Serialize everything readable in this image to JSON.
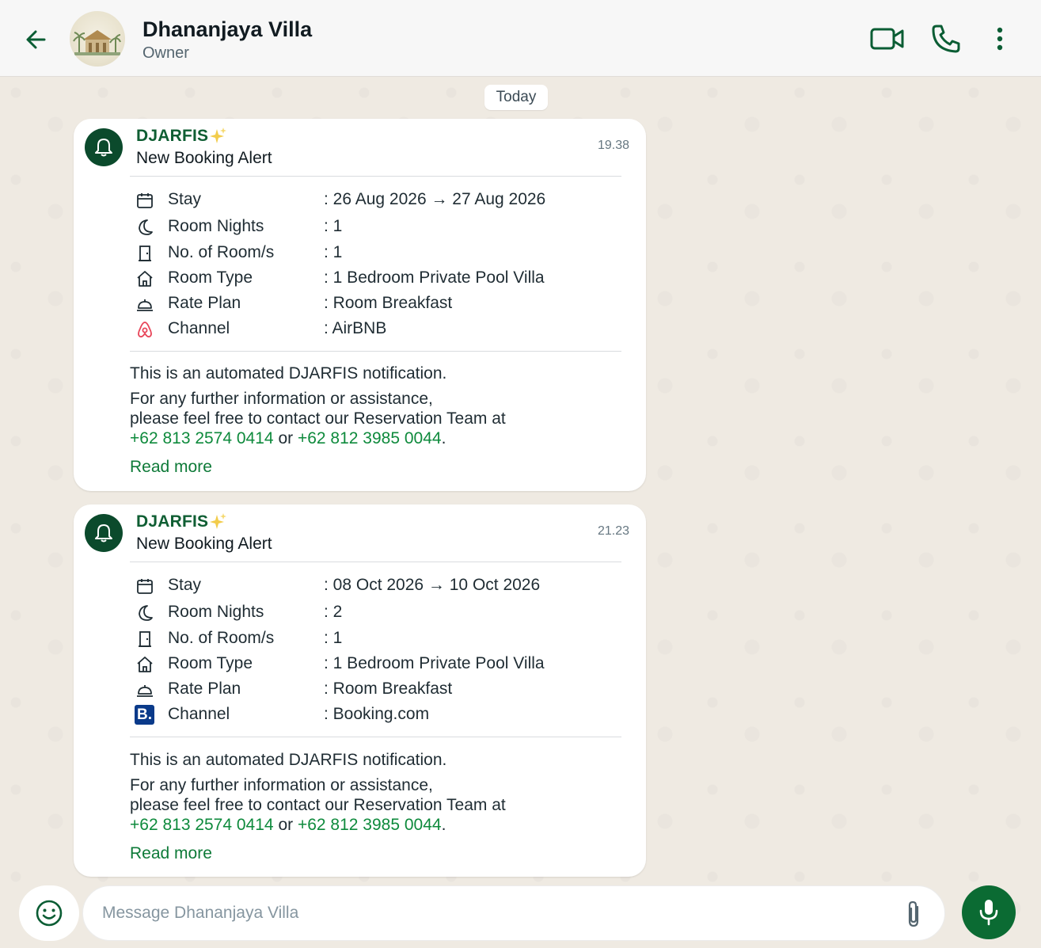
{
  "header": {
    "contact_name": "Dhananjaya Villa",
    "contact_subtitle": "Owner",
    "icons": [
      "back-arrow-icon",
      "villa-avatar",
      "video-call-icon",
      "phone-call-icon",
      "more-options-icon"
    ]
  },
  "date_chip": "Today",
  "messages": [
    {
      "sender": "DJARFIS",
      "title": "New Booking Alert",
      "time": "19.38",
      "rows": [
        {
          "icon": "calendar-icon",
          "label": "Stay",
          "value": ": 26 Aug 2026 → 27 Aug 2026"
        },
        {
          "icon": "moon-icon",
          "label": "Room Nights",
          "value": ": 1"
        },
        {
          "icon": "door-icon",
          "label": "No. of Room/s",
          "value": ": 1"
        },
        {
          "icon": "house-icon",
          "label": "Room Type",
          "value": ": 1 Bedroom Private Pool Villa"
        },
        {
          "icon": "cloche-icon",
          "label": "Rate Plan",
          "value": ": Room Breakfast"
        },
        {
          "icon": "airbnb-icon",
          "label": "Channel",
          "value": ": AirBNB"
        }
      ],
      "note": "This is an automated DJARFIS notification.",
      "contact_line1": "For any further information or assistance,",
      "contact_line2": "please feel free to contact our Reservation Team at",
      "phone1": "+62 813 2574 0414",
      "or": " or ",
      "phone2": "+62 812 3985 0044",
      "period": ".",
      "read_more": "Read more"
    },
    {
      "sender": "DJARFIS",
      "title": "New Booking Alert",
      "time": "21.23",
      "rows": [
        {
          "icon": "calendar-icon",
          "label": "Stay",
          "value": ": 08 Oct 2026 → 10 Oct 2026"
        },
        {
          "icon": "moon-icon",
          "label": "Room Nights",
          "value": ": 2"
        },
        {
          "icon": "door-icon",
          "label": "No. of Room/s",
          "value": ": 1"
        },
        {
          "icon": "house-icon",
          "label": "Room Type",
          "value": ": 1 Bedroom Private Pool Villa"
        },
        {
          "icon": "cloche-icon",
          "label": "Rate Plan",
          "value": ": Room Breakfast"
        },
        {
          "icon": "booking-com-icon",
          "label": "Channel",
          "value": ": Booking.com",
          "logo_text": "B."
        }
      ],
      "note": "This is an automated DJARFIS notification.",
      "contact_line1": "For any further information or assistance,",
      "contact_line2": "please feel free to contact our Reservation Team at",
      "phone1": "+62 813 2574 0414",
      "or": " or ",
      "phone2": "+62 812 3985 0044",
      "period": ".",
      "read_more": "Read more"
    }
  ],
  "composer": {
    "placeholder": "Message Dhananjaya Villa"
  },
  "colors": {
    "accent_green": "#0e8a3c",
    "dark_green": "#0b4a2c",
    "chat_background": "#efeae2",
    "bubble": "#ffffff",
    "airbnb": "#e8465a",
    "booking": "#0a3a8a"
  }
}
